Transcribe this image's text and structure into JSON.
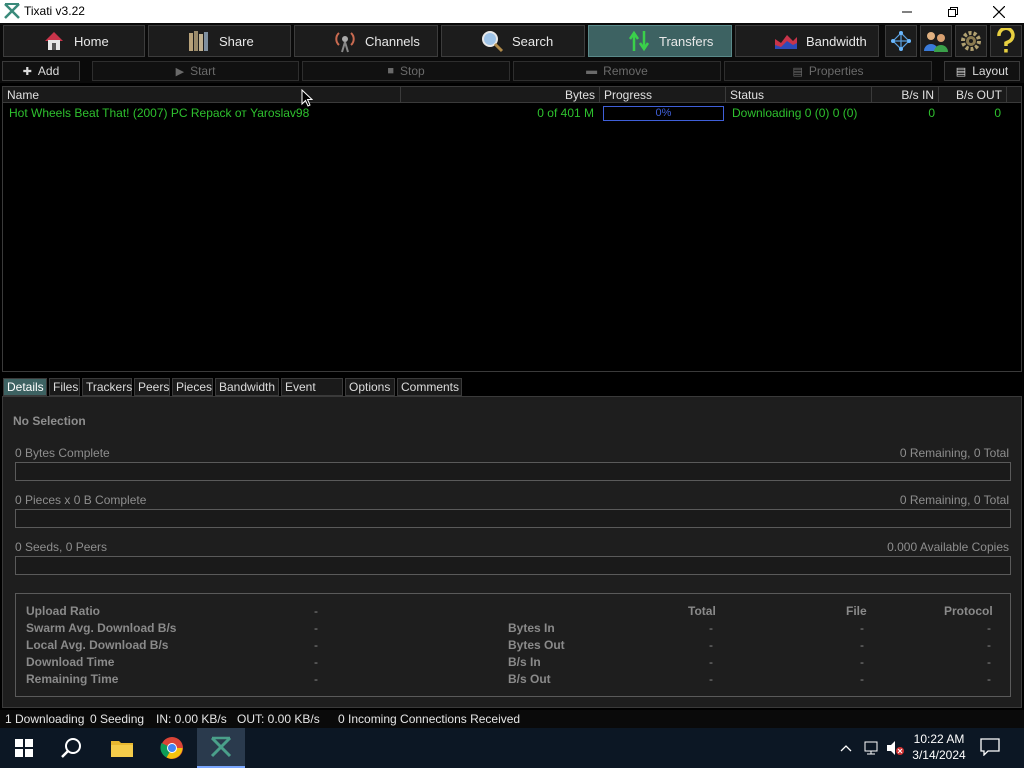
{
  "window": {
    "title": "Tixati v3.22"
  },
  "main_tabs": [
    {
      "label": "Home"
    },
    {
      "label": "Share"
    },
    {
      "label": "Channels"
    },
    {
      "label": "Search"
    },
    {
      "label": "Transfers"
    },
    {
      "label": "Bandwidth"
    }
  ],
  "toolbar": {
    "add": "Add",
    "start": "Start",
    "stop": "Stop",
    "remove": "Remove",
    "properties": "Properties",
    "layout": "Layout"
  },
  "list": {
    "columns": [
      "Name",
      "Bytes",
      "Progress",
      "Status",
      "B/s IN",
      "B/s OUT"
    ],
    "rows": [
      {
        "name": "Hot Wheels Beat That! (2007) PC  Repack от Yaroslav98",
        "bytes": "0 of 401 M",
        "progress": "0%",
        "status": "Downloading 0 (0) 0 (0)",
        "bs_in": "0",
        "bs_out": "0"
      }
    ]
  },
  "detail_tabs": [
    "Details",
    "Files",
    "Trackers",
    "Peers",
    "Pieces",
    "Bandwidth",
    "Event Log",
    "Options",
    "Comments"
  ],
  "detail": {
    "heading": "No Selection",
    "bytes_complete": "0 Bytes Complete",
    "bytes_remaining": "0 Remaining,  0 Total",
    "pieces_complete": "0 Pieces  x  0 B Complete",
    "pieces_remaining": "0 Remaining,  0 Total",
    "seeds_peers": "0 Seeds, 0 Peers",
    "available_copies": "0.000 Available Copies",
    "stats_left": [
      {
        "label": "Upload Ratio",
        "value": "-"
      },
      {
        "label": "Swarm Avg. Download B/s",
        "value": "-"
      },
      {
        "label": "Local Avg. Download B/s",
        "value": "-"
      },
      {
        "label": "Download Time",
        "value": "-"
      },
      {
        "label": "Remaining Time",
        "value": "-"
      }
    ],
    "stats_right_headers": [
      "Total",
      "File",
      "Protocol"
    ],
    "stats_right": [
      {
        "label": "Bytes In",
        "total": "-",
        "file": "-",
        "protocol": "-"
      },
      {
        "label": "Bytes Out",
        "total": "-",
        "file": "-",
        "protocol": "-"
      },
      {
        "label": "B/s In",
        "total": "-",
        "file": "-",
        "protocol": "-"
      },
      {
        "label": "B/s Out",
        "total": "-",
        "file": "-",
        "protocol": "-"
      }
    ]
  },
  "statusbar": {
    "downloading": "1 Downloading",
    "seeding": "0 Seeding",
    "in": "IN: 0.00 KB/s",
    "out": "OUT: 0.00 KB/s",
    "connections": "0 Incoming Connections Received"
  },
  "taskbar": {
    "time": "10:22 AM",
    "date": "3/14/2024"
  },
  "colors": {
    "active_tab": "#3d6262",
    "row_text": "#2ec02e",
    "progress": "#3f5fd8"
  }
}
